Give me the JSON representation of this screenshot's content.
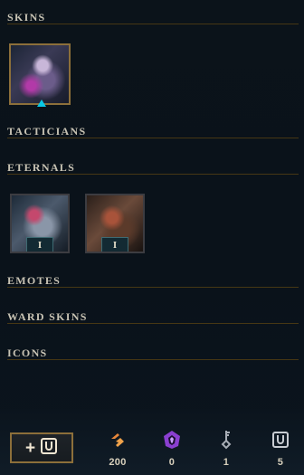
{
  "sections": {
    "skins": {
      "title": "SKINS"
    },
    "tacticians": {
      "title": "TACTICIANS"
    },
    "eternals": {
      "title": "ETERNALS",
      "items": [
        {
          "badge": "I"
        },
        {
          "badge": "I"
        }
      ]
    },
    "emotes": {
      "title": "EMOTES"
    },
    "ward_skins": {
      "title": "WARD SKINS"
    },
    "icons": {
      "title": "ICONS"
    }
  },
  "footer": {
    "add_button_label": "+",
    "currencies": [
      {
        "icon": "orange-essence-icon",
        "amount": "200",
        "color": "#e8873a"
      },
      {
        "icon": "mythic-essence-icon",
        "amount": "0",
        "color": "#b466e0"
      },
      {
        "icon": "key-icon",
        "amount": "1",
        "color": "#9aa0a8"
      },
      {
        "icon": "chest-icon",
        "amount": "5",
        "color": "#c8ccd2"
      }
    ]
  },
  "colors": {
    "accent_gold": "#c8aa6e",
    "tile_selected_border": "#8c6f3a",
    "chroma_indicator": "#0ac8e6"
  }
}
